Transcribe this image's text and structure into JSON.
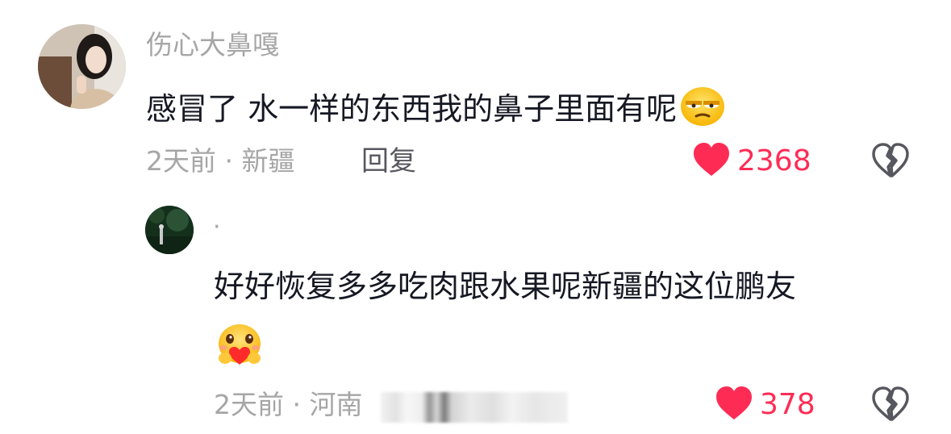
{
  "comment": {
    "username": "伤心大鼻嘎",
    "text": "感冒了 水一样的东西我的鼻子里面有呢",
    "emoji": "unamused-face-icon",
    "meta": "2天前 · 新疆",
    "reply_label": "回复",
    "like_count": "2368"
  },
  "reply": {
    "username": "·",
    "text": "好好恢复多多吃肉跟水果呢新疆的这位鹏友",
    "emoji": "heart-hug-face-icon",
    "meta": "2天前 · 河南",
    "like_count": "378"
  },
  "colors": {
    "like": "#fe2c55",
    "secondary_text": "#a6a6a6",
    "primary_text": "#161823"
  }
}
